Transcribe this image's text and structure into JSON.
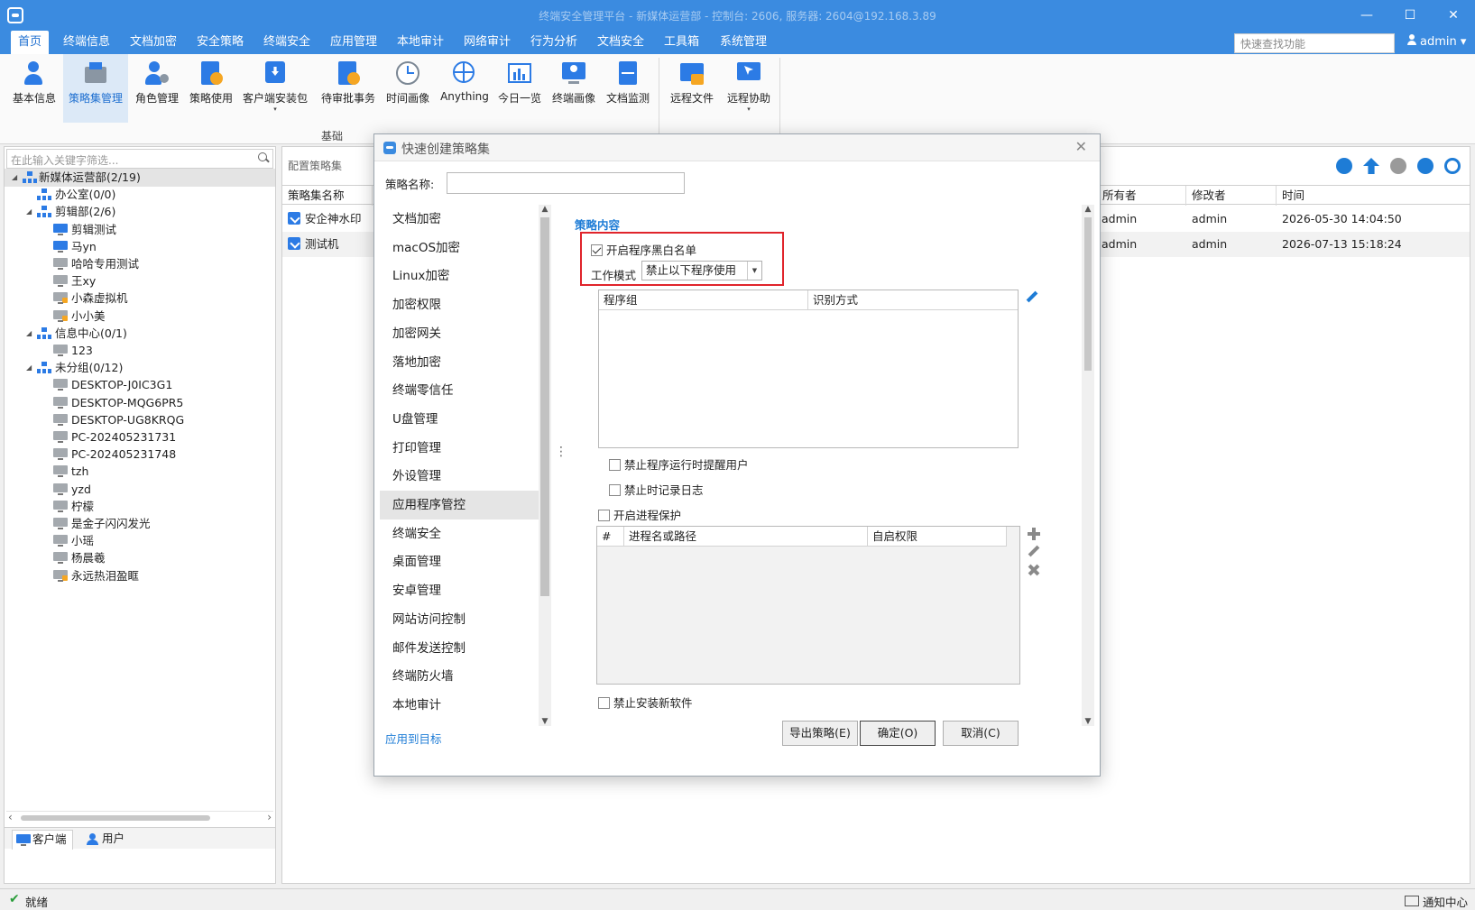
{
  "window": {
    "title": "终端安全管理平台 - 新媒体运营部 - 控制台: 2606, 服务器: 2604@192.168.3.89",
    "minimize": "—",
    "maximize": "☐",
    "close": "✕"
  },
  "menu": {
    "items": [
      "首页",
      "终端信息",
      "文档加密",
      "安全策略",
      "终端安全",
      "应用管理",
      "本地审计",
      "网络审计",
      "行为分析",
      "文档安全",
      "工具箱",
      "系统管理"
    ],
    "quick_search_placeholder": "快速查找功能",
    "user": "admin"
  },
  "ribbon": {
    "buttons": [
      "基本信息",
      "策略集管理",
      "角色管理",
      "策略使用",
      "客户端安装包",
      "待审批事务",
      "时间画像",
      "Anything",
      "今日一览",
      "终端画像",
      "文档监测",
      "远程文件",
      "远程协助"
    ],
    "dropdown_arrow": "▾",
    "group_basic": "基础"
  },
  "tree": {
    "filter_placeholder": "在此输入关键字筛选...",
    "expanded": "◢",
    "nodes": [
      {
        "label": "新媒体运营部(2/19)",
        "type": "org"
      },
      {
        "label": "办公室(0/0)",
        "type": "org"
      },
      {
        "label": "剪辑部(2/6)",
        "type": "org"
      },
      {
        "label": "剪辑测试",
        "type": "online"
      },
      {
        "label": "马yn",
        "type": "online"
      },
      {
        "label": "哈哈专用测试",
        "type": "offline"
      },
      {
        "label": "王xy",
        "type": "offline"
      },
      {
        "label": "小森虚拟机",
        "type": "offline-lock"
      },
      {
        "label": "小小美",
        "type": "offline-lock"
      },
      {
        "label": "信息中心(0/1)",
        "type": "org"
      },
      {
        "label": "123",
        "type": "offline"
      },
      {
        "label": "未分组(0/12)",
        "type": "org"
      },
      {
        "label": "DESKTOP-J0IC3G1",
        "type": "offline"
      },
      {
        "label": "DESKTOP-MQG6PR5",
        "type": "offline"
      },
      {
        "label": "DESKTOP-UG8KRQG",
        "type": "offline"
      },
      {
        "label": "PC-202405231731",
        "type": "offline"
      },
      {
        "label": "PC-202405231748",
        "type": "offline"
      },
      {
        "label": "tzh",
        "type": "offline"
      },
      {
        "label": "yzd",
        "type": "offline"
      },
      {
        "label": "柠檬",
        "type": "offline"
      },
      {
        "label": "是金子闪闪发光",
        "type": "offline"
      },
      {
        "label": "小瑶",
        "type": "offline"
      },
      {
        "label": "杨晨羲",
        "type": "offline"
      },
      {
        "label": "永远热泪盈眶",
        "type": "offline-lock"
      }
    ],
    "scroll_left": "‹",
    "scroll_right": "›",
    "tab_client": "客户端",
    "tab_user": "用户"
  },
  "main": {
    "breadcrumb": "配置策略集",
    "columns": [
      "策略集名称",
      "所有者",
      "修改者",
      "时间"
    ],
    "rows": [
      {
        "name": "安企神水印",
        "owner": "admin",
        "modifier": "admin",
        "time": "2026-05-30 14:04:50"
      },
      {
        "name": "测试机",
        "owner": "admin",
        "modifier": "admin",
        "time": "2026-07-13 15:18:24"
      }
    ]
  },
  "dialog": {
    "title": "快速创建策略集",
    "close": "✕",
    "name_label": "策略名称:",
    "categories": [
      "文档加密",
      "macOS加密",
      "Linux加密",
      "加密权限",
      "加密网关",
      "落地加密",
      "终端零信任",
      "U盘管理",
      "打印管理",
      "外设管理",
      "应用程序管控",
      "终端安全",
      "桌面管理",
      "安卓管理",
      "网站访问控制",
      "邮件发送控制",
      "终端防火墙",
      "本地审计"
    ],
    "scroll_up": "▲",
    "scroll_down": "▼",
    "grip": "⋮",
    "section_title": "策略内容",
    "enable_blacklist": "开启程序黑白名单",
    "mode_label": "工作模式",
    "mode_value": "禁止以下程序使用",
    "mode_arrow": "▼",
    "grid1_columns": [
      "程序组",
      "识别方式"
    ],
    "notify_on_block": "禁止程序运行时提醒用户",
    "log_on_block": "禁止时记录日志",
    "enable_process_protect": "开启进程保护",
    "grid2_columns": [
      "#",
      "进程名或路径",
      "自启权限"
    ],
    "block_install": "禁止安装新软件",
    "apply_link": "应用到目标",
    "export_button": "导出策略(E)",
    "ok_button": "确定(O)",
    "cancel_button": "取消(C)"
  }
}
